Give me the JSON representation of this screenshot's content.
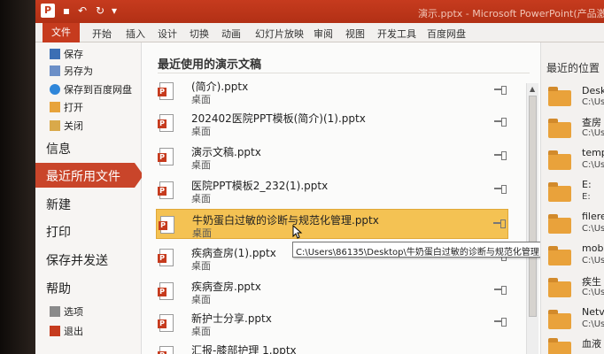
{
  "window": {
    "title": "演示.pptx - Microsoft PowerPoint(产品激"
  },
  "ribbon": {
    "tabs": [
      "文件",
      "开始",
      "插入",
      "设计",
      "切换",
      "动画",
      "幻灯片放映",
      "审阅",
      "视图",
      "开发工具",
      "百度网盘"
    ]
  },
  "nav": {
    "small_top": [
      "保存",
      "另存为",
      "保存到百度网盘",
      "打开",
      "关闭"
    ],
    "big": [
      "信息",
      "最近所用文件",
      "新建",
      "打印",
      "保存并发送",
      "帮助"
    ],
    "small_bottom": [
      "选项",
      "退出"
    ]
  },
  "recent": {
    "title": "最近使用的演示文稿",
    "items": [
      {
        "name": "(简介).pptx",
        "location": "桌面"
      },
      {
        "name": "202402医院PPT模板(简介)(1).pptx",
        "location": "桌面"
      },
      {
        "name": "演示文稿.pptx",
        "location": "桌面"
      },
      {
        "name": "医院PPT模板2_232(1).pptx",
        "location": "桌面"
      },
      {
        "name": "牛奶蛋白过敏的诊断与规范化管理.pptx",
        "location": "桌面"
      },
      {
        "name": "疾病查房(1).pptx",
        "location": "桌面"
      },
      {
        "name": "疾病查房.pptx",
        "location": "桌面"
      },
      {
        "name": "新护士分享.pptx",
        "location": "桌面"
      },
      {
        "name": "汇报-膝部护理 1.pptx",
        "location": ""
      }
    ],
    "tooltip": "C:\\Users\\86135\\Desktop\\牛奶蛋白过敏的诊断与规范化管理.pptx"
  },
  "places": {
    "title": "最近的位置",
    "items": [
      {
        "name": "Deskt",
        "path": "C:\\Us"
      },
      {
        "name": "查房",
        "path": "C:\\Us"
      },
      {
        "name": "temp",
        "path": "C:\\Us"
      },
      {
        "name": "E:",
        "path": "E:"
      },
      {
        "name": "filere",
        "path": "C:\\Us"
      },
      {
        "name": "mob",
        "path": "C:\\Us"
      },
      {
        "name": "疾生",
        "path": "C:\\Us"
      },
      {
        "name": "Netv",
        "path": "C:\\Us"
      },
      {
        "name": "血液",
        "path": ""
      }
    ]
  }
}
